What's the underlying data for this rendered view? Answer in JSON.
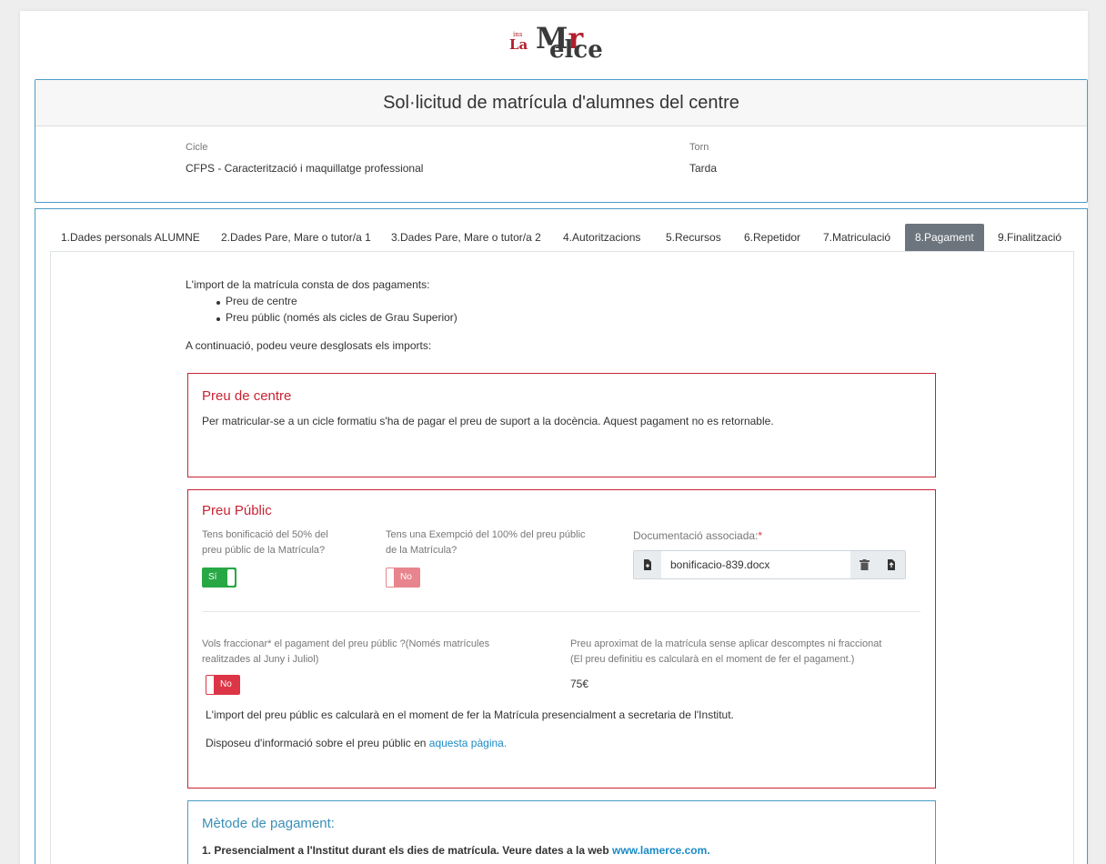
{
  "logo": {
    "ins": "ins",
    "la": "La",
    "m": "M",
    "r": "r",
    "erce": "elce",
    "accent": "`"
  },
  "header": {
    "title": "Sol·licitud de matrícula d'alumnes del centre",
    "cicle_label": "Cicle",
    "cicle_value": "CFPS - Caracterització i maquillatge professional",
    "torn_label": "Torn",
    "torn_value": "Tarda"
  },
  "tabs": [
    {
      "label": "1.Dades personals ALUMNE",
      "active": false
    },
    {
      "label": "2.Dades Pare, Mare o tutor/a 1",
      "active": false
    },
    {
      "label": "3.Dades Pare, Mare o tutor/a 2",
      "active": false
    },
    {
      "label": "4.Autoritzacions",
      "active": false
    },
    {
      "label": "5.Recursos",
      "active": false
    },
    {
      "label": "6.Repetidor",
      "active": false
    },
    {
      "label": "7.Matriculació",
      "active": false
    },
    {
      "label": "8.Pagament",
      "active": true
    },
    {
      "label": "9.Finalització",
      "active": false
    }
  ],
  "intro": {
    "line1": "L'import de la matrícula consta de dos pagaments:",
    "bullets": [
      "Preu de centre",
      "Preu públic (només als cicles de Grau Superior)"
    ],
    "line2": "A continuació, podeu veure desglosats els imports:"
  },
  "preu_centre": {
    "title": "Preu de centre",
    "text": "Per matricular-se a un cicle formatiu s'ha de pagar el preu de suport a la docència. Aquest pagament no es retornable."
  },
  "preu_public": {
    "title": "Preu Públic",
    "bonificacio_line1": "Tens bonificació del 50% del",
    "bonificacio_line2": "preu públic de la Matrícula?",
    "bonificacio_toggle": "Sí",
    "exempcio_line1": "Tens una Exempció del 100% del preu públic",
    "exempcio_line2": "de la Matrícula?",
    "exempcio_toggle": "No",
    "doc_label": "Documentació associada:",
    "doc_required": "*",
    "doc_filename": "bonificacio-839.docx",
    "fraccionar_line1": "Vols fraccionar* el pagament del preu públic ?(Només matrícules",
    "fraccionar_line2": "realitzades al Juny i Juliol)",
    "fraccionar_toggle": "No",
    "preu_aprox_line1": "Preu aproximat de la matrícula sense aplicar descomptes ni fraccionat",
    "preu_aprox_line2": "(El preu definitiu es calcularà en el moment de fer el pagament.)",
    "preu_value": "75€",
    "import_text": "L'import del preu públic es calcularà en el moment de fer la Matrícula presencialment a secretaria de l'Institut.",
    "info_text": "Disposeu d'informació sobre el preu públic en ",
    "info_link": "aquesta pàgina."
  },
  "metode": {
    "title": "Mètode de pagament:",
    "step1": "1. Presencialment a l'Institut durant els dies de matrícula. Veure dates a la web ",
    "step1_link": "www.lamerce.com."
  },
  "colors": {
    "accent_blue": "#4a9cc7",
    "danger": "#c82333",
    "success": "#28a745",
    "tab_active": "#6c757d",
    "link": "#1a8ac6"
  },
  "icons": {
    "file": "file-icon",
    "trash": "trash-icon",
    "upload": "upload-icon"
  }
}
